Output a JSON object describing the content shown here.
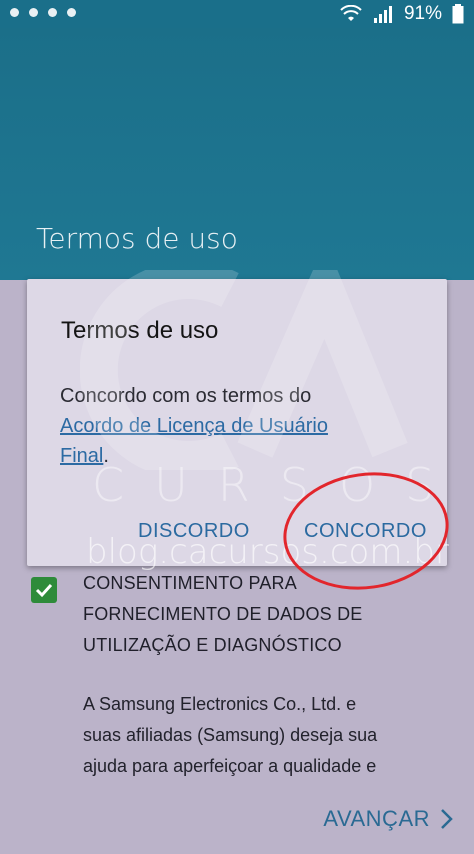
{
  "status_bar": {
    "battery": "91%",
    "colors": {
      "bar": "#1a6f8a",
      "icons": "#ffffff"
    }
  },
  "header": {
    "title": "Termos de uso"
  },
  "dialog": {
    "title": "Termos de uso",
    "body_text": "Concordo com os termos do ",
    "link_text_line1": "Acordo de Licença de Usuário",
    "link_text_line2": "Final",
    "period": ".",
    "buttons": {
      "disagree": "DISCORDO",
      "agree": "CONCORDO"
    }
  },
  "content": {
    "checkbox_checked": true,
    "section_heading": [
      "CONSENTIMENTO PARA",
      "FORNECIMENTO DE DADOS DE",
      "UTILIZAÇÃO E DIAGNÓSTICO"
    ],
    "paragraph": [
      "A Samsung Electronics Co., Ltd. e",
      "suas afiliadas (Samsung) deseja sua",
      "ajuda para aperfeiçoar a qualidade e"
    ],
    "next_button": "AVANÇAR"
  },
  "watermark": {
    "brand": "CURSOS",
    "url": "blog.cacursos.com.br"
  },
  "colors": {
    "accent": "#2b6aa0",
    "checkbox": "#2e8b3a",
    "annotation": "#e2262c"
  }
}
